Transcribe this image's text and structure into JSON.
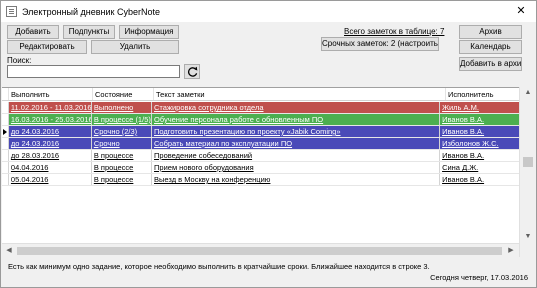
{
  "window": {
    "title": "Электронный дневник CyberNote",
    "close_glyph": "✕"
  },
  "toolbar": {
    "add": "Добавить",
    "subtasks": "Подпункты",
    "info": "Информация",
    "edit": "Редактировать",
    "delete": "Удалить"
  },
  "summary": {
    "total": "Всего заметок в таблице: 7",
    "urgent": "Срочных заметок: 2 (настроить)"
  },
  "right_buttons": {
    "archive": "Архив",
    "calendar": "Календарь",
    "add_archive": "Добавить в архив"
  },
  "search": {
    "label": "Поиск:",
    "value": "",
    "placeholder": ""
  },
  "table": {
    "headers": [
      "Выполнить",
      "Состояние",
      "Текст заметки",
      "Исполнитель"
    ],
    "rows": [
      {
        "due": "11.02.2016 - 11.03.2016",
        "state": "Выполнено",
        "text": "Стажировка сотрудника отдела",
        "owner": "Жиль А.М.",
        "bg": "#c0504d",
        "fg": "#ffffff",
        "underline": true
      },
      {
        "due": "16.03.2016 - 25.03.2016",
        "state": "В процессе (1/5)",
        "text": "Обучение персонала работе с обновленным ПО",
        "owner": "Иванов В.А.",
        "bg": "#4caf50",
        "fg": "#ffffff",
        "underline": true
      },
      {
        "due": "до 24.03.2016",
        "state": "Срочно (2/3)",
        "text": "Подготовить презентацию по проекту «Jabik Coming»",
        "owner": "Иванов В.А.",
        "bg": "#4a4ab8",
        "fg": "#ffffff",
        "underline": true,
        "selected": true
      },
      {
        "due": "до 24.03.2016",
        "state": "Срочно",
        "text": "Собрать материал по эксплуатации ПО",
        "owner": "Изболонов Ж.С.",
        "bg": "#4a4ab8",
        "fg": "#ffffff",
        "underline": true
      },
      {
        "due": "до 28.03.2016",
        "state": "В процессе",
        "text": "Проведение собеседований",
        "owner": "Иванов В.А.",
        "bg": "#ffffff",
        "fg": "#000000",
        "underline": true
      },
      {
        "due": "04.04.2016",
        "state": "В процессе",
        "text": "Прием нового оборудования",
        "owner": "Сина Д.Ж.",
        "bg": "#ffffff",
        "fg": "#000000",
        "underline": true
      },
      {
        "due": "05.04.2016",
        "state": "В процессе",
        "text": "Выезд в Москву на конференцию",
        "owner": "Иванов В.А.",
        "bg": "#ffffff",
        "fg": "#000000",
        "underline": true
      }
    ]
  },
  "status": {
    "message": "Есть как минимум одно задание, которое необходимо выполнить в кратчайшие сроки. Ближайшее находится в строке 3.",
    "date": "Сегодня четверг, 17.03.2016"
  },
  "icons": {
    "refresh": "refresh-icon",
    "selected_row": "row-pointer-icon"
  }
}
